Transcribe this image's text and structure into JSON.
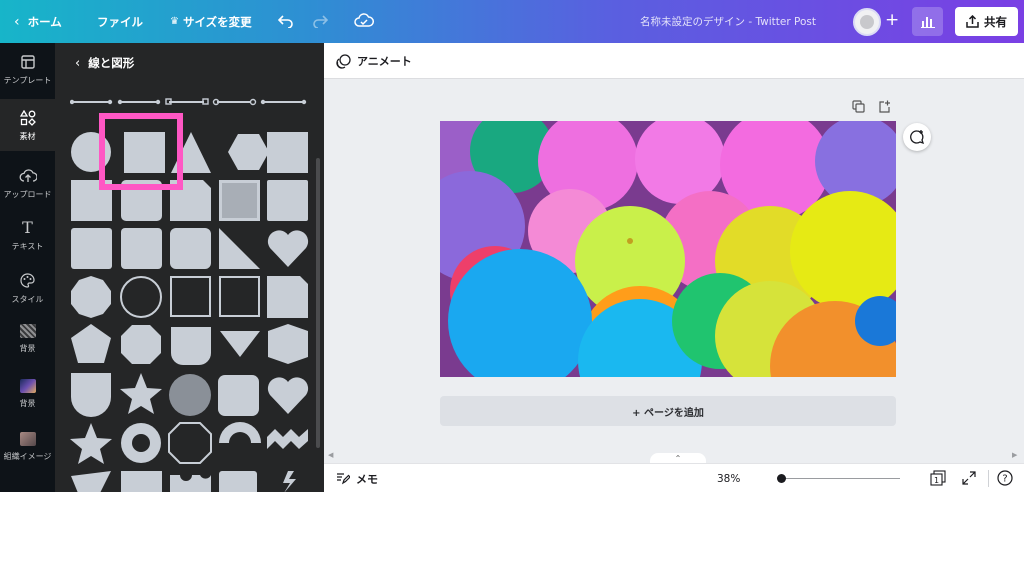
{
  "topbar": {
    "home_label": "ホーム",
    "file_label": "ファイル",
    "resize_label": "サイズを変更",
    "design_title": "名称未設定のデザイン - Twitter Post",
    "share_label": "共有",
    "icons": [
      "chevron-left-icon",
      "crown-icon",
      "undo-icon",
      "redo-icon",
      "cloud-save-icon",
      "avatar",
      "plus-icon",
      "analytics-icon",
      "share-icon"
    ]
  },
  "rail": {
    "items": [
      {
        "label": "テンプレート",
        "icon": "template-icon"
      },
      {
        "label": "素材",
        "icon": "elements-icon"
      },
      {
        "label": "アップロード",
        "icon": "upload-icon"
      },
      {
        "label": "テキスト",
        "icon": "text-icon"
      },
      {
        "label": "スタイル",
        "icon": "palette-icon"
      },
      {
        "label": "背景",
        "icon": "background-pattern-icon"
      },
      {
        "label": "背景",
        "icon": "background-photo-icon"
      },
      {
        "label": "組織イメージ",
        "icon": "brand-image-icon"
      }
    ]
  },
  "panel": {
    "title": "線と図形",
    "shape_color": "#c8ced6",
    "highlight_color": "#ff57c4"
  },
  "workspace": {
    "animate_label": "アニメート",
    "add_page_label": "+ ページを追加"
  },
  "bottombar": {
    "memo_label": "メモ",
    "zoom": "38%",
    "page_count": "1"
  },
  "colors": {
    "topbar_gradient": [
      "#17b5c9",
      "#7a3fe4"
    ],
    "panel_bg": "#252627",
    "rail_bg": "#0e1318",
    "workspace_bg": "#eceef1"
  }
}
